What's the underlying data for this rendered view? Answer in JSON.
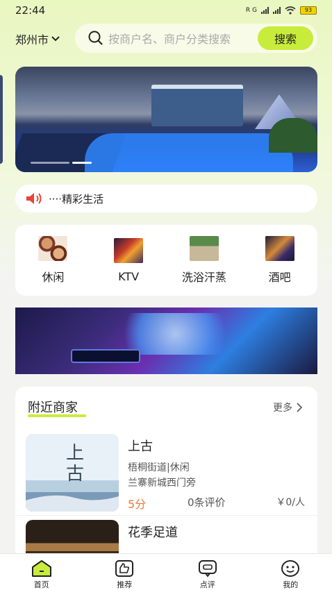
{
  "status_bar": {
    "time": "22:44",
    "battery": "93",
    "signal": "R G"
  },
  "header": {
    "city": "郑州市",
    "search_placeholder": "按商户名、商户分类搜索",
    "search_button": "搜索"
  },
  "banner": {
    "slide_count": 3,
    "active_index": 1
  },
  "notice": {
    "text": "····精彩生活"
  },
  "categories": [
    {
      "label": "休闲"
    },
    {
      "label": "KTV"
    },
    {
      "label": "洗浴汗蒸"
    },
    {
      "label": "酒吧"
    }
  ],
  "nearby": {
    "title": "附近商家",
    "more": "更多",
    "shops": [
      {
        "name": "上古",
        "address_line1": "梧桐街道|休闲",
        "address_line2": "兰寨新城西门旁",
        "rating": "5分",
        "reviews": "0条评价",
        "price": "￥0/人"
      },
      {
        "name": "花季足道",
        "address_line1": "",
        "address_line2": "",
        "rating": "",
        "reviews": "",
        "price": ""
      }
    ]
  },
  "tabbar": {
    "items": [
      {
        "label": "首页",
        "icon": "home-icon"
      },
      {
        "label": "推荐",
        "icon": "thumbs-up-icon"
      },
      {
        "label": "点评",
        "icon": "comment-icon"
      },
      {
        "label": "我的",
        "icon": "smiley-icon"
      }
    ]
  },
  "colors": {
    "accent": "#c8ec3b",
    "rating": "#e87a34"
  }
}
